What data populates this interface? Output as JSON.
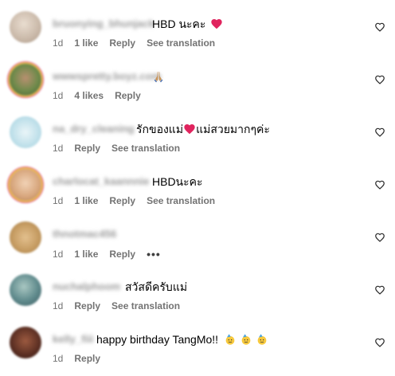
{
  "comments": [
    {
      "username": "bruonying_bhunjack",
      "text": "HBD นะคะ",
      "emoji": "heart",
      "time": "1d",
      "likes": "1 like",
      "reply": "Reply",
      "translate": "See translation",
      "avatar_color": "#c9b8a8"
    },
    {
      "username": "wwwspretty.boyz.com",
      "text": "",
      "emoji": "praying-hands",
      "time": "1d",
      "likes": "4 likes",
      "reply": "Reply",
      "avatar_color": "#6d8a4a"
    },
    {
      "username": "na_dry_cleaning",
      "text_before": "รักของแม่",
      "text_after": "แม่สวยมากๆค่ะ",
      "emoji": "heart",
      "time": "1d",
      "reply": "Reply",
      "translate": "See translation",
      "avatar_color": "#bfe0ea"
    },
    {
      "username": "charlocat_kaannnie",
      "text": "HBDนะคะ",
      "time": "1d",
      "likes": "1 like",
      "reply": "Reply",
      "translate": "See translation",
      "avatar_color": "#d6a47a"
    },
    {
      "username": "thnotmac456",
      "text": "",
      "time": "1d",
      "likes": "1 like",
      "reply": "Reply",
      "more": "•••",
      "avatar_color": "#c49a60"
    },
    {
      "username": "nuchalphoom",
      "text": "สวัสดีครับแม่",
      "time": "1d",
      "reply": "Reply",
      "translate": "See translation",
      "avatar_color": "#5f8a8c"
    },
    {
      "username": "kelly_fiii",
      "text": "happy birthday TangMo!!",
      "emoji": "face-with-party-hat",
      "time": "1d",
      "reply": "Reply",
      "avatar_color": "#5a2e22"
    }
  ],
  "colors": {
    "meta": "#737373",
    "heart": "#e0245e",
    "username_blur": "#9a9a9a"
  },
  "icons": {
    "like": "heart-outline-icon"
  }
}
